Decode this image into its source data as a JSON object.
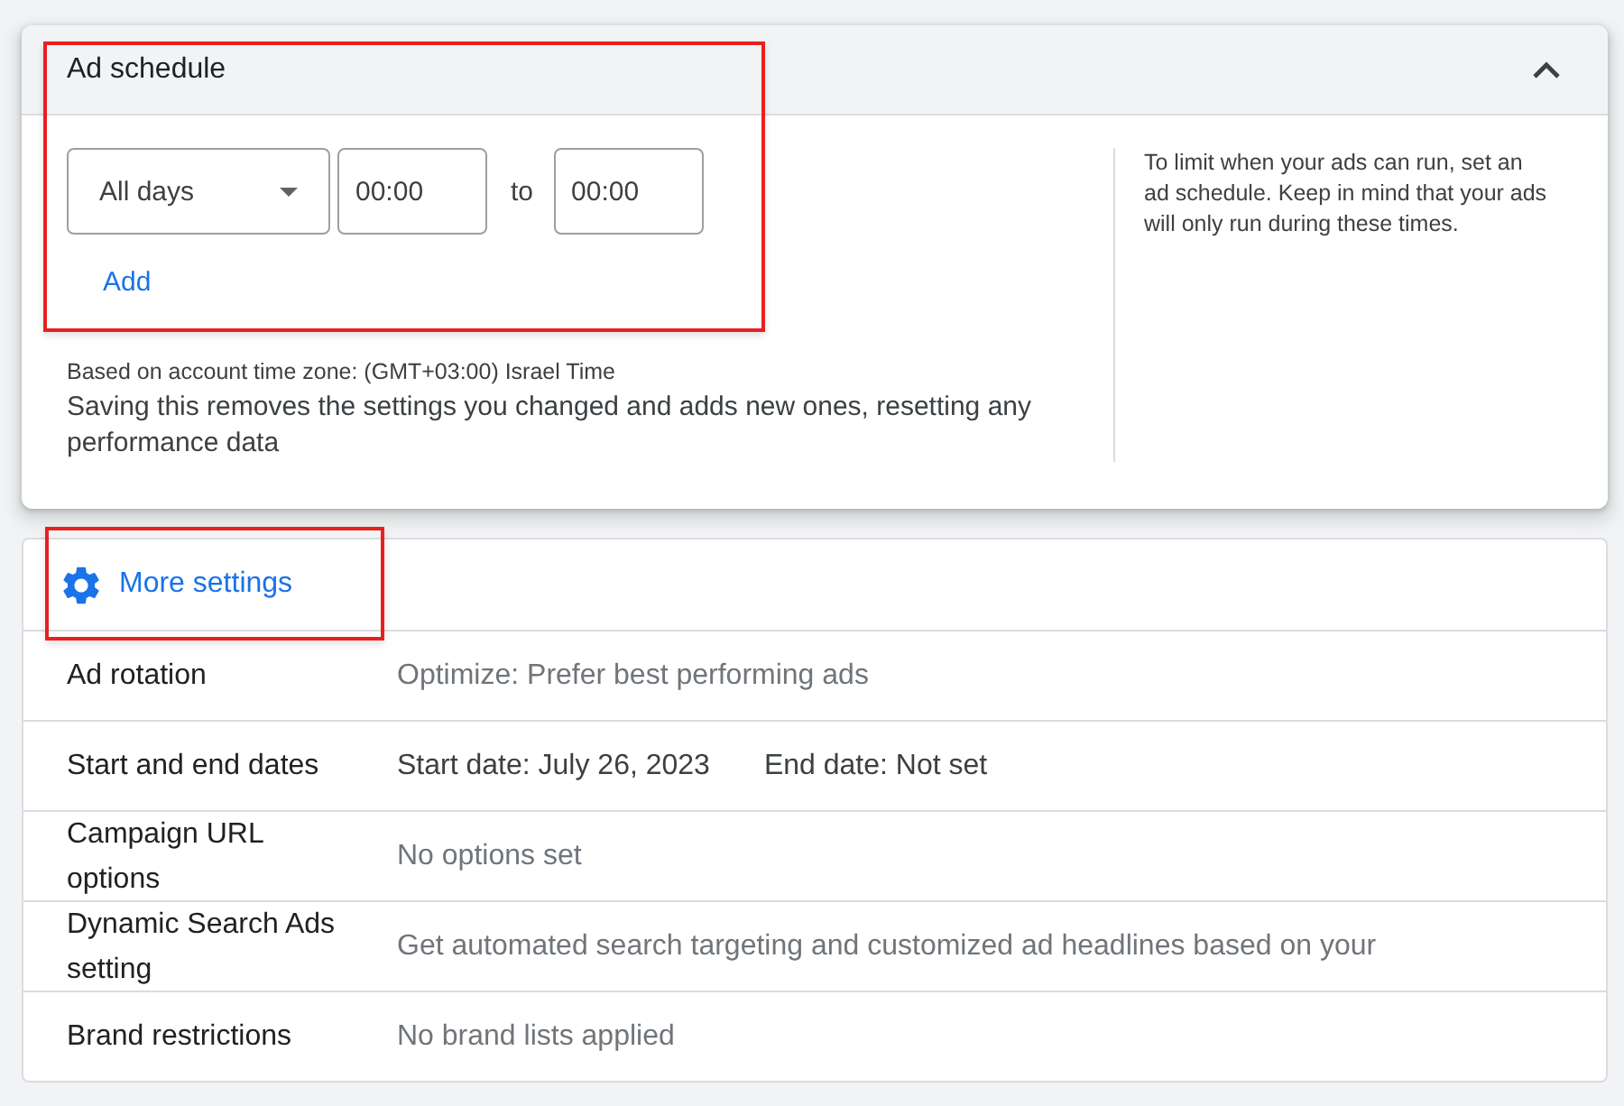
{
  "ad_schedule": {
    "title": "Ad schedule",
    "expanded": true,
    "schedule": {
      "day": "All days",
      "start": "00:00",
      "separator": "to",
      "end": "00:00"
    },
    "add_link": "Add",
    "time_zone_note": "Based on account time zone: (GMT+03:00) Israel Time",
    "warning": "Saving this removes the settings you changed and adds new ones, resetting any performance data",
    "help_text": "To limit when your ads can run, set an ad schedule. Keep in mind that your ads will only run during these times."
  },
  "more_settings": {
    "title": "More settings",
    "rows": [
      {
        "kind": "summary",
        "label": "Ad rotation",
        "values": [
          "Optimize: Prefer best performing ads"
        ]
      },
      {
        "kind": "dates",
        "label": "Start and end dates",
        "values": [
          "Start date: July 26, 2023",
          "End date: Not set"
        ]
      },
      {
        "kind": "summary",
        "label": "Campaign URL options",
        "values": [
          "No options set"
        ]
      },
      {
        "kind": "summary",
        "label": "Dynamic Search Ads setting",
        "values": [
          "Get automated search targeting and customized ad headlines based on your"
        ]
      },
      {
        "kind": "summary",
        "label": "Brand restrictions",
        "values": [
          "No brand lists applied"
        ]
      }
    ]
  }
}
